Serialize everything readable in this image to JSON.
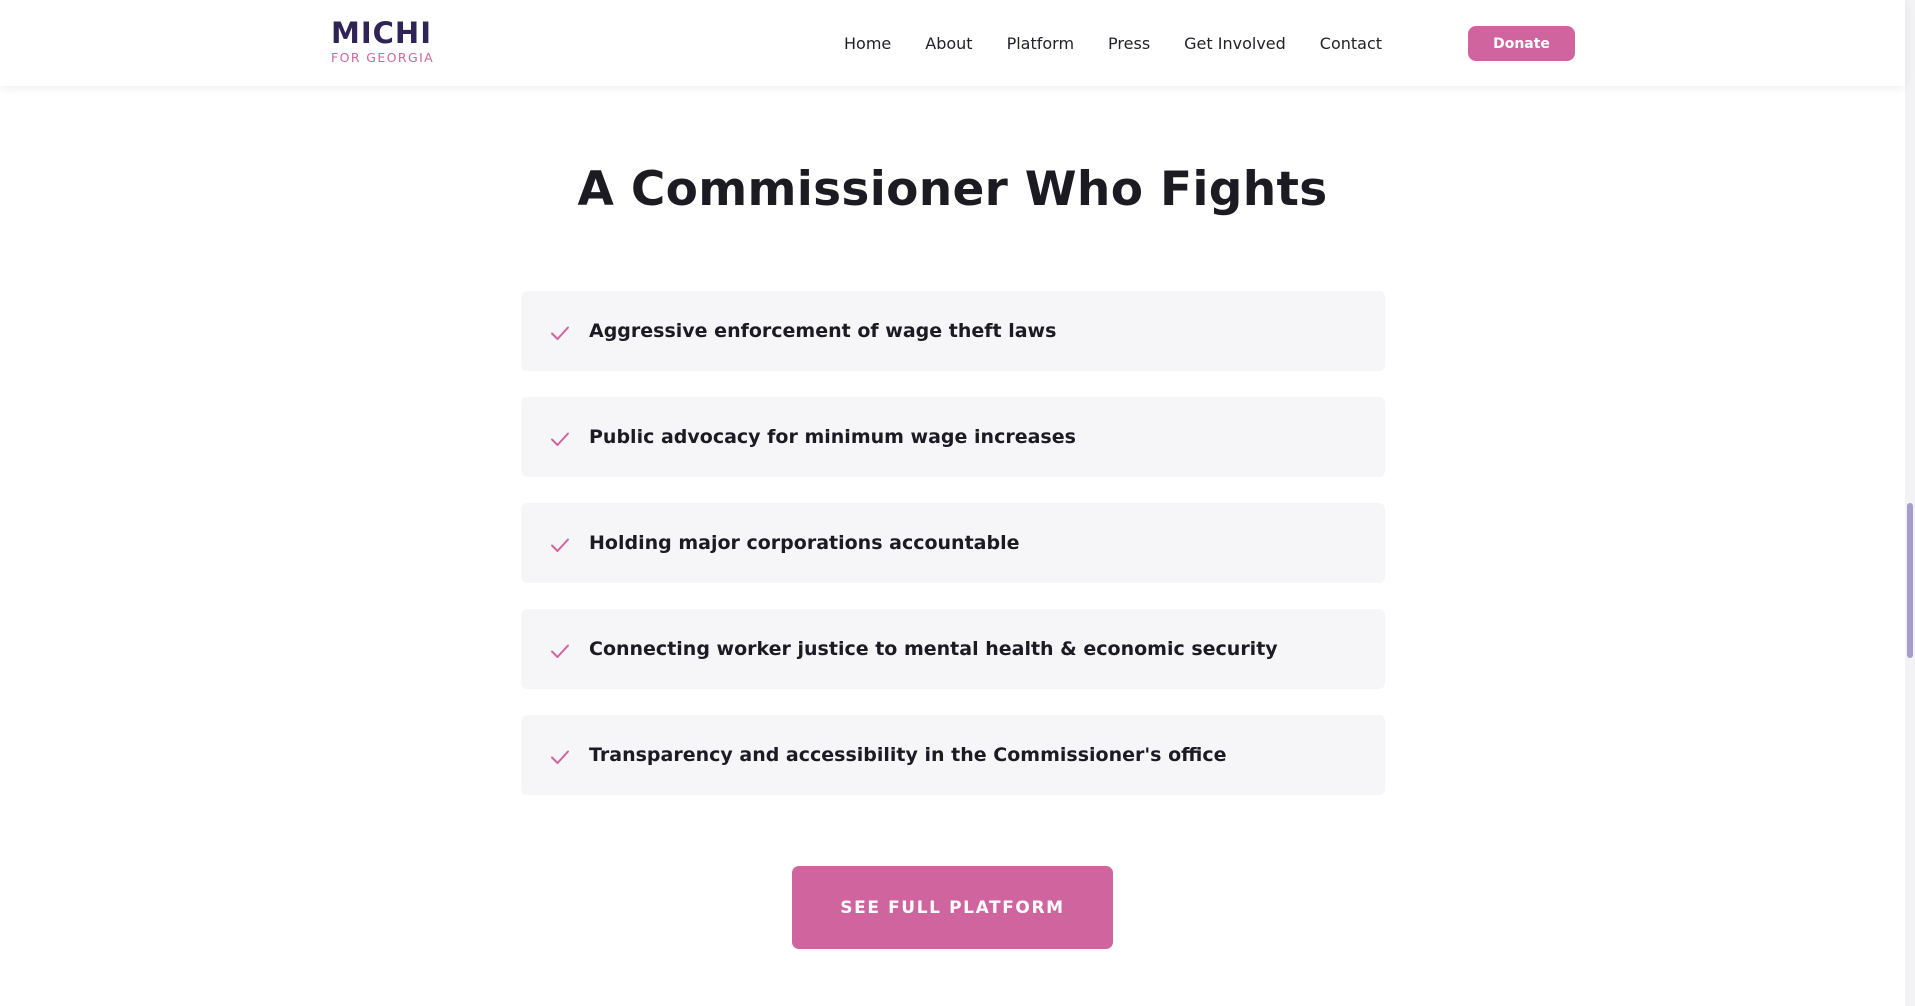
{
  "header": {
    "logo_main": "MICHI",
    "logo_sub": "FOR GEORGIA",
    "nav": [
      {
        "label": "Home"
      },
      {
        "label": "About"
      },
      {
        "label": "Platform"
      },
      {
        "label": "Press"
      },
      {
        "label": "Get Involved"
      },
      {
        "label": "Contact"
      }
    ],
    "donate_label": "Donate"
  },
  "section": {
    "title": "A Commissioner Who Fights",
    "items": [
      {
        "icon": "check-icon",
        "text": "Aggressive enforcement of wage theft laws"
      },
      {
        "icon": "check-icon",
        "text": "Public advocacy for minimum wage increases"
      },
      {
        "icon": "check-icon",
        "text": "Holding major corporations accountable"
      },
      {
        "icon": "check-icon",
        "text": "Connecting worker justice to mental health & economic security"
      },
      {
        "icon": "check-icon",
        "text": "Transparency and accessibility in the Commissioner's office"
      }
    ],
    "cta_label": "SEE FULL PLATFORM"
  },
  "colors": {
    "brand_navy": "#2e2456",
    "accent_pink": "#d0649e",
    "item_background": "#f6f6f8",
    "text_dark": "#1c1b22"
  }
}
